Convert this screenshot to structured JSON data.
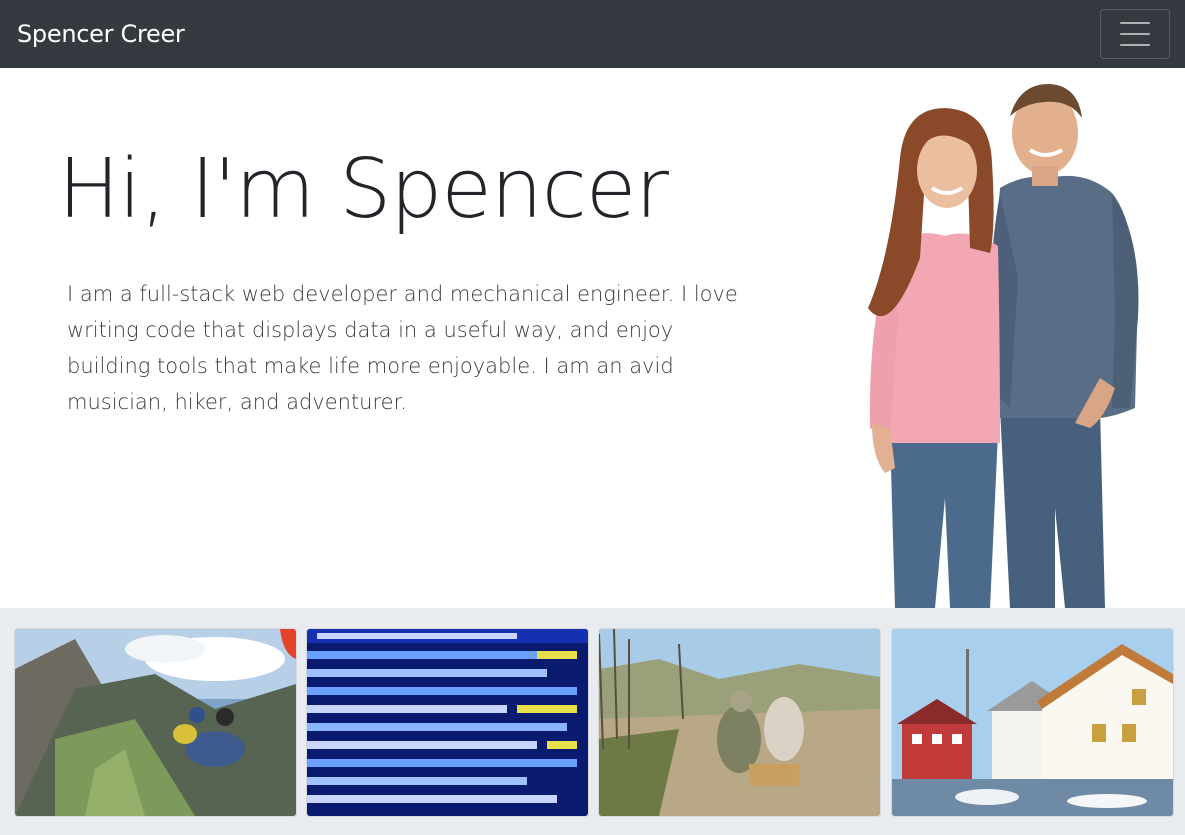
{
  "navbar": {
    "brand": "Spencer Creer",
    "toggler_icon": "hamburger-menu-icon"
  },
  "hero": {
    "title": "Hi, I'm Spencer",
    "lead": "I am a full-stack web developer and mechanical engineer. I love writing code that displays data in a useful way, and enjoy building tools that make life more enjoyable. I am an avid musician, hiker, and adventurer."
  },
  "gallery": {
    "tiles": [
      {
        "name": "paragliding-photo"
      },
      {
        "name": "code-photo"
      },
      {
        "name": "soldier-satellite-photo"
      },
      {
        "name": "harbor-houses-photo"
      }
    ]
  },
  "colors": {
    "navbar_bg": "#343a40",
    "gallery_bg": "#e9ecef",
    "text": "#212529"
  }
}
